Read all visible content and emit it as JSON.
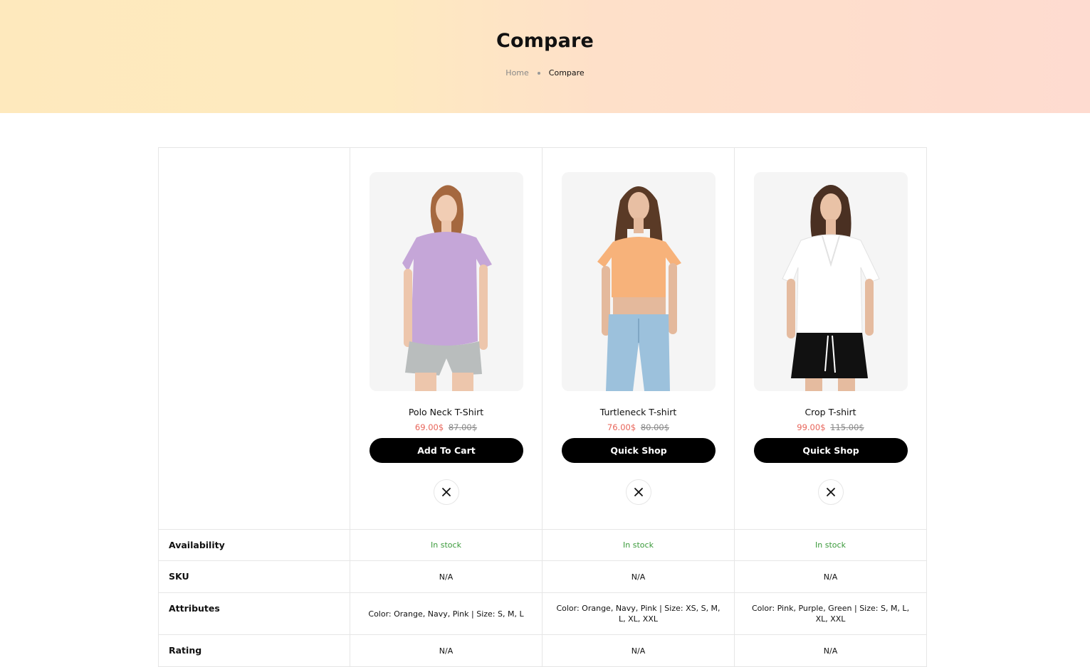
{
  "header": {
    "title": "Compare",
    "breadcrumb": {
      "home": "Home",
      "current": "Compare"
    }
  },
  "table": {
    "row_labels": {
      "availability": "Availability",
      "sku": "SKU",
      "attributes": "Attributes",
      "rating": "Rating"
    },
    "products": [
      {
        "name": "Polo Neck T-Shirt",
        "price": "69.00$",
        "old_price": "87.00$",
        "button": "Add To Cart",
        "availability": "In stock",
        "sku": "N/A",
        "attributes": "Color: Orange, Navy, Pink | Size: S, M, L",
        "rating": "N/A"
      },
      {
        "name": "Turtleneck T-shirt",
        "price": "76.00$",
        "old_price": "80.00$",
        "button": "Quick Shop",
        "availability": "In stock",
        "sku": "N/A",
        "attributes": "Color: Orange, Navy, Pink | Size: XS, S, M, L, XL, XXL",
        "rating": "N/A"
      },
      {
        "name": "Crop T-shirt",
        "price": "99.00$",
        "old_price": "115.00$",
        "button": "Quick Shop",
        "availability": "In stock",
        "sku": "N/A",
        "attributes": "Color: Pink, Purple, Green | Size: S, M, L, XL, XXL",
        "rating": "N/A"
      }
    ]
  },
  "colors": {
    "sale_price": "#e8655a",
    "in_stock": "#3a9a3a",
    "button_bg": "#000000"
  },
  "icons": {
    "remove": "close-icon"
  }
}
